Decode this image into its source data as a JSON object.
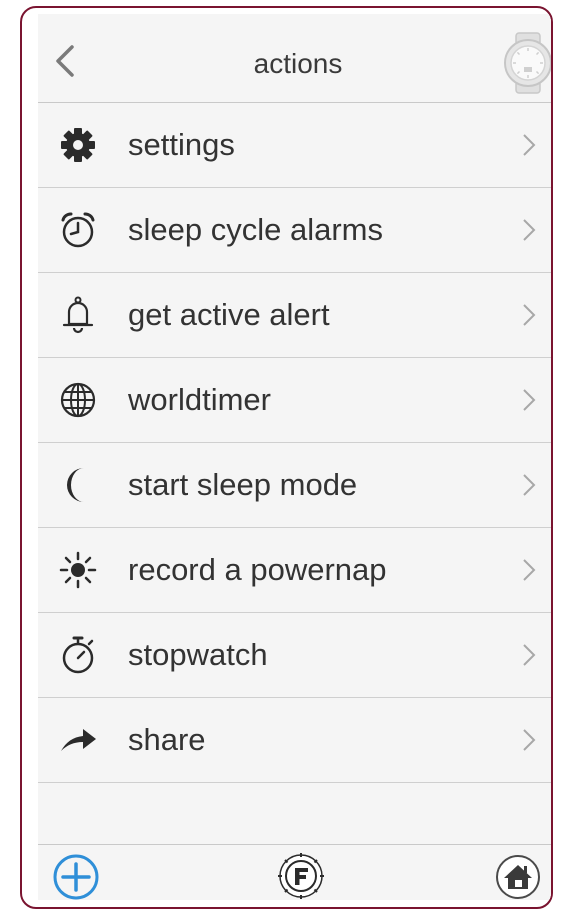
{
  "header": {
    "title": "actions",
    "back_icon": "chevron-left-icon",
    "watch_icon": "watch-icon"
  },
  "menu": {
    "items": [
      {
        "label": "settings",
        "icon": "gear-icon"
      },
      {
        "label": "sleep cycle alarms",
        "icon": "alarm-clock-icon"
      },
      {
        "label": "get active alert",
        "icon": "bell-icon"
      },
      {
        "label": "worldtimer",
        "icon": "globe-icon"
      },
      {
        "label": "start sleep mode",
        "icon": "moon-icon"
      },
      {
        "label": "record a powernap",
        "icon": "sun-icon"
      },
      {
        "label": "stopwatch",
        "icon": "stopwatch-icon"
      },
      {
        "label": "share",
        "icon": "share-arrow-icon"
      }
    ]
  },
  "bottom_bar": {
    "add_icon": "plus-circle-icon",
    "logo_icon": "brand-logo-icon",
    "home_icon": "home-icon"
  },
  "colors": {
    "frame_border": "#7a1430",
    "accent_blue": "#2f8fd8",
    "background": "#f5f5f5",
    "text": "#333333",
    "divider": "#cfcfcf"
  }
}
